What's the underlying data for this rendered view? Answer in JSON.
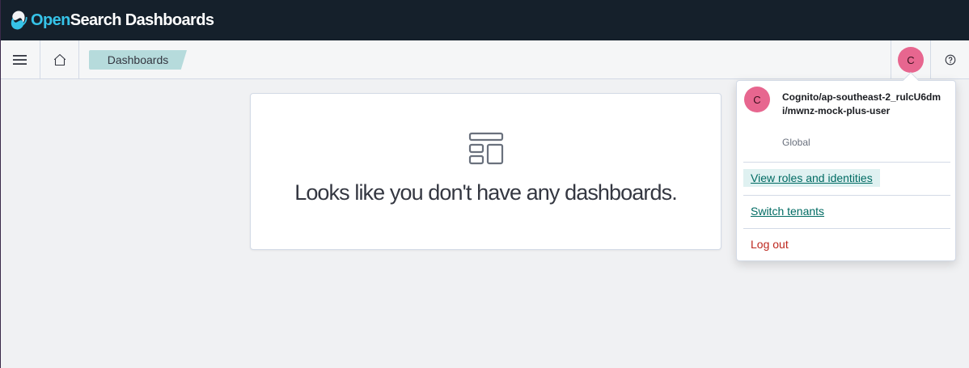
{
  "header": {
    "brand_open": "Open",
    "brand_search": "Search",
    "brand_rest": " Dashboards",
    "logo_icon": "opensearch-logo-icon"
  },
  "nav": {
    "menu_icon": "hamburger-menu-icon",
    "home_icon": "home-icon",
    "breadcrumb": "Dashboards",
    "avatar_initial": "C",
    "help_icon": "help-icon"
  },
  "empty_state": {
    "icon": "dashboard-app-icon",
    "title": "Looks like you don't have any dashboards."
  },
  "user_menu": {
    "avatar_initial": "C",
    "username": "Cognito/ap-southeast-2_rulcU6dmi/mwnz-mock-plus-user",
    "tenant": "Global",
    "view_roles": "View roles and identities",
    "switch_tenants": "Switch tenants",
    "logout": "Log out"
  },
  "colors": {
    "header_bg": "#15202b",
    "accent_teal": "#006b63",
    "avatar_pink": "#e7668f",
    "logout_red": "#bd271e"
  }
}
